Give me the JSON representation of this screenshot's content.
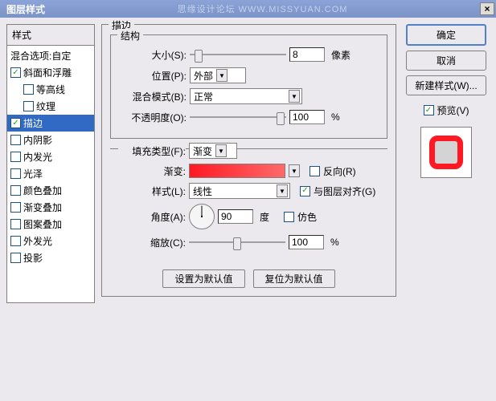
{
  "window": {
    "title": "图层样式",
    "watermark": "思缘设计论坛 WWW.MISSYUAN.COM"
  },
  "left": {
    "header": "样式",
    "blend": "混合选项:自定",
    "items": [
      {
        "label": "斜面和浮雕",
        "checked": true
      },
      {
        "label": "等高线",
        "checked": false,
        "sub": true
      },
      {
        "label": "纹理",
        "checked": false,
        "sub": true
      },
      {
        "label": "描边",
        "checked": true,
        "selected": true
      },
      {
        "label": "内阴影",
        "checked": false
      },
      {
        "label": "内发光",
        "checked": false
      },
      {
        "label": "光泽",
        "checked": false
      },
      {
        "label": "颜色叠加",
        "checked": false
      },
      {
        "label": "渐变叠加",
        "checked": false
      },
      {
        "label": "图案叠加",
        "checked": false
      },
      {
        "label": "外发光",
        "checked": false
      },
      {
        "label": "投影",
        "checked": false
      }
    ]
  },
  "stroke": {
    "group_label": "描边",
    "structure_label": "结构",
    "size_label": "大小(S):",
    "size_value": "8",
    "size_unit": "像素",
    "position_label": "位置(P):",
    "position_value": "外部",
    "blend_label": "混合模式(B):",
    "blend_value": "正常",
    "opacity_label": "不透明度(O):",
    "opacity_value": "100",
    "percent": "%",
    "filltype_label": "填充类型(F):",
    "filltype_value": "渐变",
    "gradient_label": "渐变:",
    "reverse_label": "反向(R)",
    "style_label": "样式(L):",
    "style_value": "线性",
    "align_label": "与图层对齐(G)",
    "angle_label": "角度(A):",
    "angle_value": "90",
    "angle_unit": "度",
    "dither_label": "仿色",
    "scale_label": "缩放(C):",
    "scale_value": "100",
    "set_default": "设置为默认值",
    "reset_default": "复位为默认值"
  },
  "right": {
    "ok": "确定",
    "cancel": "取消",
    "new_style": "新建样式(W)...",
    "preview": "预览(V)"
  }
}
